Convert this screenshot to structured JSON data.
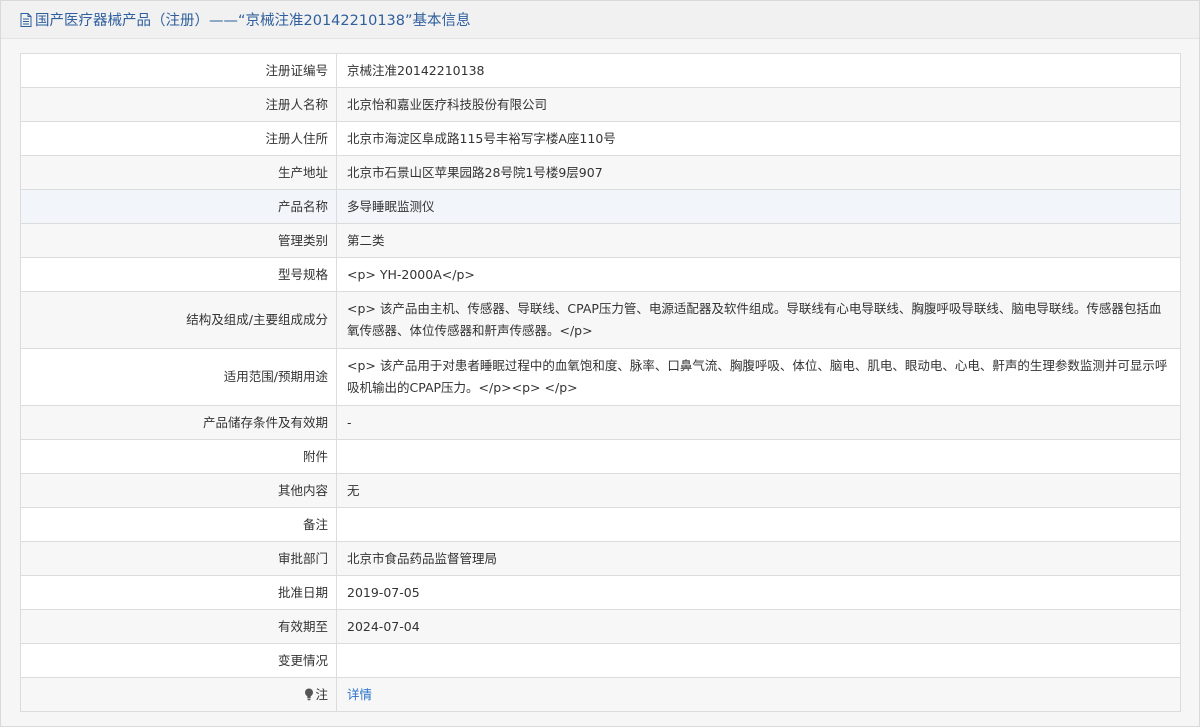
{
  "header": {
    "title": "国产医疗器械产品（注册）——“京械注准20142210138”基本信息"
  },
  "rows": [
    {
      "label": "注册证编号",
      "value": "京械注准20142210138"
    },
    {
      "label": "注册人名称",
      "value": "北京怡和嘉业医疗科技股份有限公司"
    },
    {
      "label": "注册人住所",
      "value": "北京市海淀区阜成路115号丰裕写字楼A座110号"
    },
    {
      "label": "生产地址",
      "value": "北京市石景山区苹果园路28号院1号楼9层907"
    },
    {
      "label": "产品名称",
      "value": "多导睡眠监测仪"
    },
    {
      "label": "管理类别",
      "value": "第二类"
    },
    {
      "label": "型号规格",
      "value": "<p> YH-2000A</p>"
    },
    {
      "label": "结构及组成/主要组成成分",
      "value": "<p> 该产品由主机、传感器、导联线、CPAP压力管、电源适配器及软件组成。导联线有心电导联线、胸腹呼吸导联线、脑电导联线。传感器包括血氧传感器、体位传感器和鼾声传感器。</p>"
    },
    {
      "label": "适用范围/预期用途",
      "value": "<p> 该产品用于对患者睡眠过程中的血氧饱和度、脉率、口鼻气流、胸腹呼吸、体位、脑电、肌电、眼动电、心电、鼾声的生理参数监测并可显示呼吸机输出的CPAP压力。</p><p> </p>"
    },
    {
      "label": "产品储存条件及有效期",
      "value": "-"
    },
    {
      "label": "附件",
      "value": ""
    },
    {
      "label": "其他内容",
      "value": "无"
    },
    {
      "label": "备注",
      "value": ""
    },
    {
      "label": "审批部门",
      "value": "北京市食品药品监督管理局"
    },
    {
      "label": "批准日期",
      "value": "2019-07-05"
    },
    {
      "label": "有效期至",
      "value": "2024-07-04"
    },
    {
      "label": "变更情况",
      "value": ""
    }
  ],
  "note_row": {
    "label": "注",
    "link": "详情"
  },
  "colors": {
    "header_text": "#2f5f9e",
    "link": "#2a73c9",
    "border": "#dcdcdc"
  },
  "icons": {
    "header": "document-icon",
    "note": "lightbulb-icon"
  }
}
